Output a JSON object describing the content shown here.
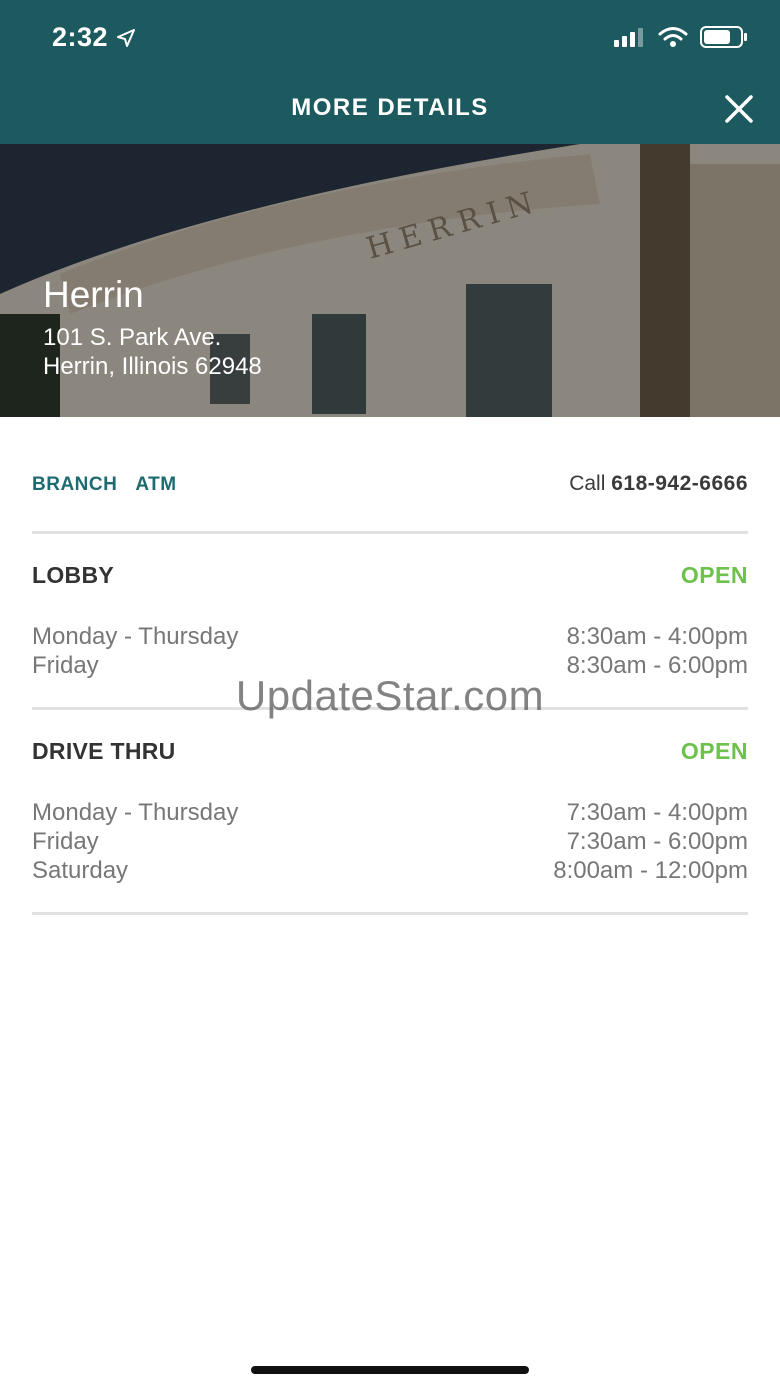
{
  "status_bar": {
    "time": "2:32"
  },
  "header": {
    "title": "MORE DETAILS"
  },
  "branch": {
    "name": "Herrin",
    "address_line1": "101 S. Park Ave.",
    "address_line2": "Herrin, Illinois 62948",
    "building_inscription": "HERRIN"
  },
  "tabs": [
    {
      "label": "BRANCH"
    },
    {
      "label": "ATM"
    }
  ],
  "call": {
    "prefix": "Call",
    "phone": "618-942-6666"
  },
  "lobby": {
    "title": "LOBBY",
    "status": "OPEN",
    "hours": [
      {
        "days": "Monday - Thursday",
        "time": "8:30am - 4:00pm"
      },
      {
        "days": "Friday",
        "time": "8:30am - 6:00pm"
      }
    ]
  },
  "drive_thru": {
    "title": "DRIVE THRU",
    "status": "OPEN",
    "hours": [
      {
        "days": "Monday - Thursday",
        "time": "7:30am - 4:00pm"
      },
      {
        "days": "Friday",
        "time": "7:30am - 6:00pm"
      },
      {
        "days": "Saturday",
        "time": "8:00am - 12:00pm"
      }
    ]
  },
  "watermark": "UpdateStar.com",
  "colors": {
    "header_bg": "#1d5a60",
    "accent": "#1d6a70",
    "open_green": "#6cc24a"
  }
}
